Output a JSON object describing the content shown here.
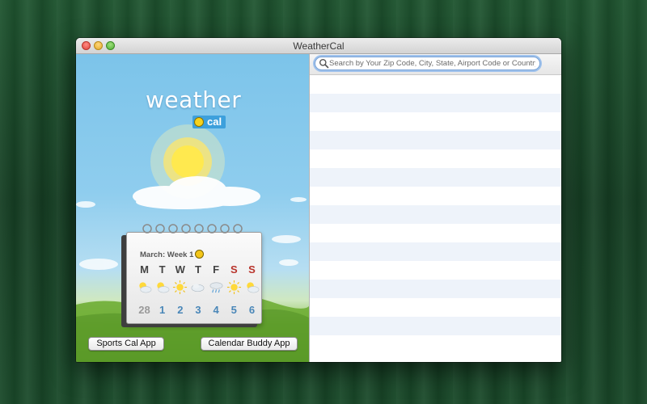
{
  "window": {
    "title": "WeatherCal"
  },
  "logo": {
    "word": "weather",
    "sub": "cal"
  },
  "search": {
    "placeholder": "Search by Your Zip Code, City, State, Airport Code or Country",
    "value": ""
  },
  "calendar": {
    "week_label": "March: Week 1",
    "days": [
      {
        "letter": "M",
        "weekend": false
      },
      {
        "letter": "T",
        "weekend": false
      },
      {
        "letter": "W",
        "weekend": false
      },
      {
        "letter": "T",
        "weekend": false
      },
      {
        "letter": "F",
        "weekend": false
      },
      {
        "letter": "S",
        "weekend": true
      },
      {
        "letter": "S",
        "weekend": true
      }
    ],
    "icons": [
      "sun-cloud-icon",
      "sun-cloud-icon",
      "sun-icon",
      "cloud-icon",
      "rain-cloud-icon",
      "sun-icon",
      "sun-cloud-icon"
    ],
    "dates": [
      "28",
      "1",
      "2",
      "3",
      "4",
      "5",
      "6"
    ]
  },
  "buttons": {
    "sports_label": "Sports Cal App",
    "buddy_label": "Calendar Buddy App"
  },
  "colors": {
    "accent": "#3da0dc",
    "focus_ring": "#9fc2ec",
    "row_alt": "#eef3fa",
    "weekend": "#b8332b"
  }
}
